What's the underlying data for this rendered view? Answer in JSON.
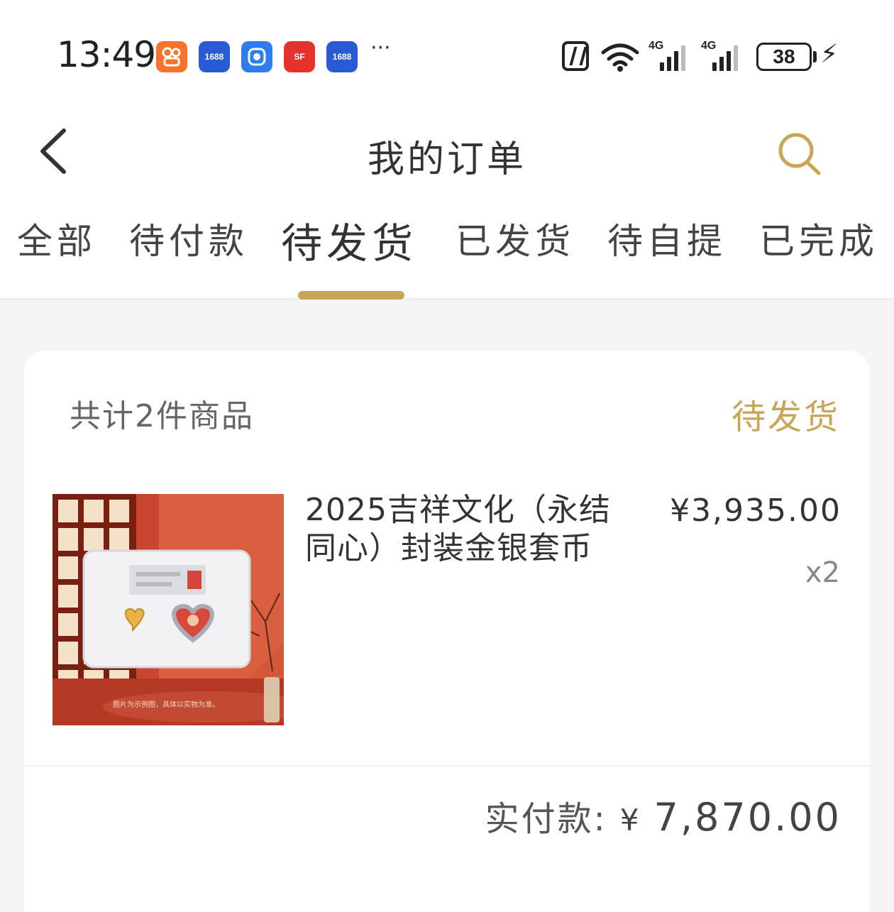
{
  "status_bar": {
    "time": "13:49",
    "battery": "38",
    "signal_label_1": "4G",
    "signal_label_2": "4G",
    "more": "···",
    "app_icons": [
      {
        "name": "kuaishou-app-icon",
        "color": "#f5732a"
      },
      {
        "name": "1688-app-icon",
        "label": "1688",
        "color": "#2a5bd7"
      },
      {
        "name": "blue-app-icon",
        "color": "#2f7bf0"
      },
      {
        "name": "sf-express-app-icon",
        "label": "SF",
        "color": "#e6322c"
      },
      {
        "name": "1688-app-icon-2",
        "label": "1688",
        "color": "#2a5bd7"
      }
    ]
  },
  "header": {
    "title": "我的订单"
  },
  "tabs": [
    {
      "label": "全部"
    },
    {
      "label": "待付款"
    },
    {
      "label": "待发货",
      "active": true
    },
    {
      "label": "已发货"
    },
    {
      "label": "待自提"
    },
    {
      "label": "已完成"
    }
  ],
  "order": {
    "count_text": "共计2件商品",
    "status": "待发货",
    "product": {
      "name": "2025吉祥文化（永结同心）封装金银套币",
      "price": "¥3,935.00",
      "quantity": "x2"
    },
    "total_label": "实付款:",
    "total_currency": "¥",
    "total_amount": "7,870.00"
  },
  "colors": {
    "accent": "#c7a657",
    "background": "#f5f5f5"
  }
}
